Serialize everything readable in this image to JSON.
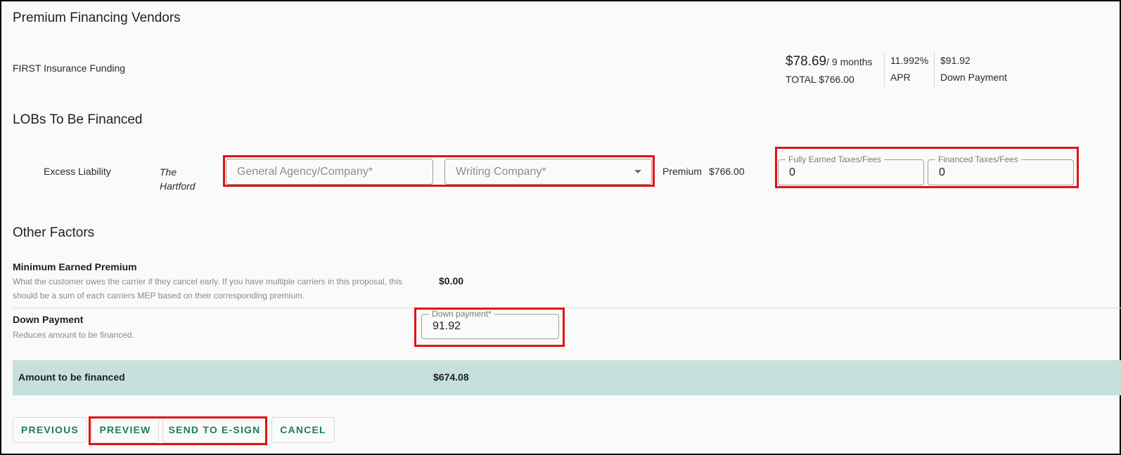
{
  "vendors": {
    "title": "Premium Financing Vendors",
    "vendor_name": "FIRST Insurance Funding",
    "monthly_amount": "$78.69",
    "term": "/ 9 months",
    "total": "TOTAL $766.00",
    "apr_value": "11.992%",
    "apr_label": "APR",
    "down_value": "$91.92",
    "down_label": "Down Payment"
  },
  "lobs": {
    "title": "LOBs To Be Financed",
    "rows": [
      {
        "line": "Excess Liability",
        "carrier": "The Hartford",
        "general_agency_placeholder": "General Agency/Company*",
        "writing_company_placeholder": "Writing Company*",
        "premium_label": "Premium",
        "premium_value": "$766.00",
        "fully_earned_label": "Fully Earned Taxes/Fees",
        "fully_earned_value": "0",
        "financed_label": "Financed Taxes/Fees",
        "financed_value": "0"
      }
    ]
  },
  "other": {
    "title": "Other Factors",
    "mep_title": "Minimum Earned Premium",
    "mep_desc_1": "What the customer owes the carrier if they cancel early. If you have multiple carriers in this proposal, this",
    "mep_desc_2": "should be a sum of each carriers MEP based on their corresponding premium.",
    "mep_value": "$0.00",
    "down_title": "Down Payment",
    "down_desc": "Reduces amount to be financed.",
    "down_field_label": "Down payment*",
    "down_field_value": "91.92",
    "financed_label": "Amount to be financed",
    "financed_value": "$674.08"
  },
  "actions": {
    "previous": "PREVIOUS",
    "preview": "PREVIEW",
    "esign": "SEND TO E-SIGN",
    "cancel": "CANCEL"
  },
  "colors": {
    "highlight": "#e31212",
    "accent": "#1e7b64",
    "financed_band": "#c6e0dc"
  }
}
